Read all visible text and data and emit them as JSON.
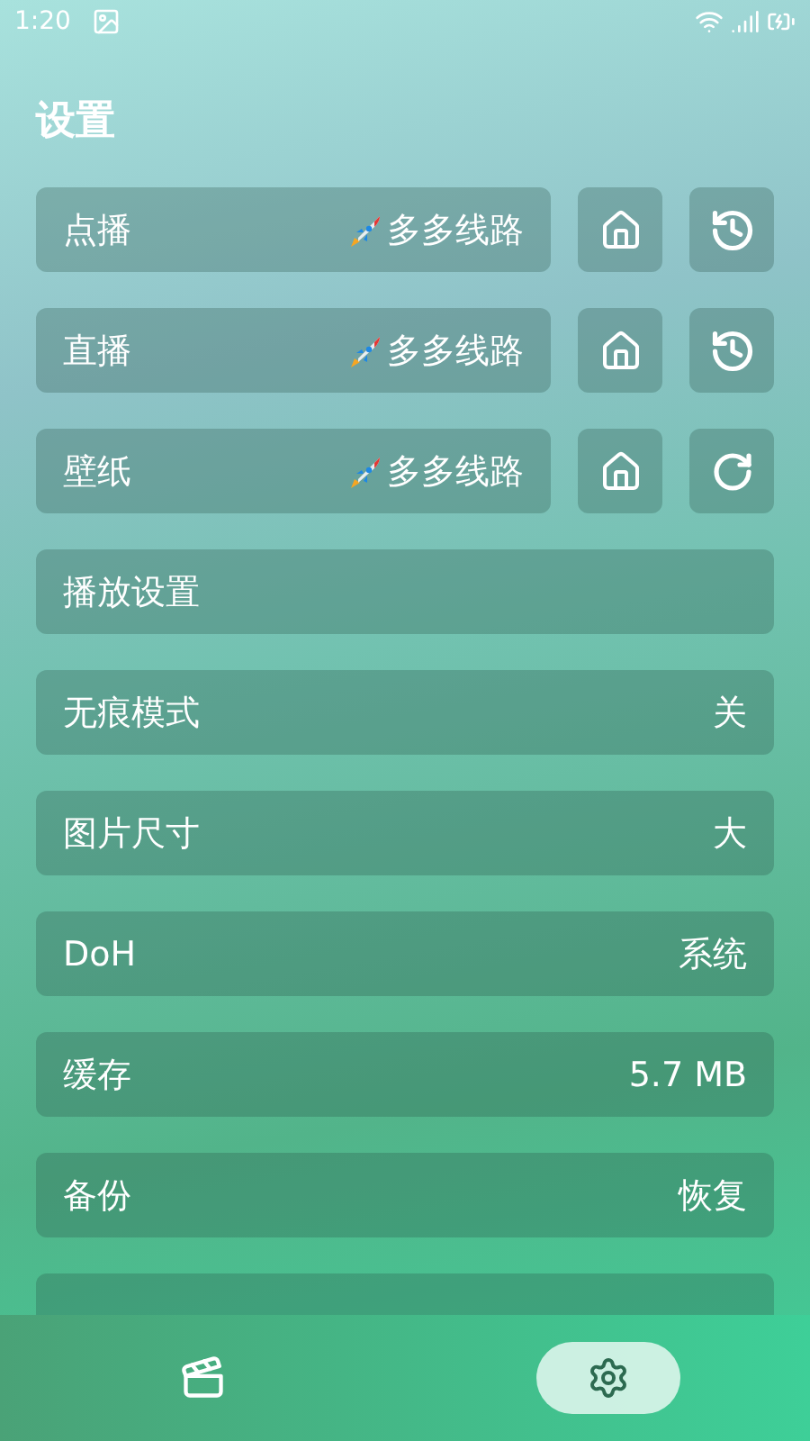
{
  "status_bar": {
    "time": "1:20"
  },
  "title": "设置",
  "source_rows": [
    {
      "label": "点播",
      "value": "多多线路",
      "kind": "history"
    },
    {
      "label": "直播",
      "value": "多多线路",
      "kind": "history"
    },
    {
      "label": "壁纸",
      "value": "多多线路",
      "kind": "refresh"
    }
  ],
  "settings": [
    {
      "label": "播放设置"
    },
    {
      "label": "无痕模式",
      "value": "关"
    },
    {
      "label": "图片尺寸",
      "value": "大"
    },
    {
      "label": "DoH",
      "value": "系统"
    },
    {
      "label": "缓存",
      "value": "5.7 MB"
    },
    {
      "label": "备份",
      "value": "恢复"
    }
  ],
  "more_below": true,
  "nav": [
    {
      "kind": "film",
      "selected": false
    },
    {
      "kind": "settings",
      "selected": true
    }
  ]
}
